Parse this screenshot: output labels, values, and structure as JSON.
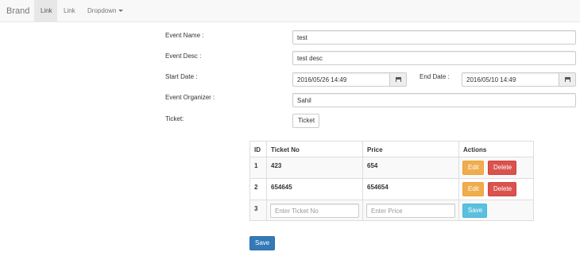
{
  "navbar": {
    "brand": "Brand",
    "items": [
      {
        "label": "Link",
        "active": true
      },
      {
        "label": "Link",
        "active": false
      },
      {
        "label": "Dropdown",
        "active": false
      }
    ]
  },
  "form": {
    "event_name": {
      "label": "Event Name :",
      "value": "test"
    },
    "event_desc": {
      "label": "Event Desc :",
      "value": "test desc"
    },
    "start_date": {
      "label": "Start Date :",
      "value": "2016/05/26 14:49"
    },
    "end_date": {
      "label": "End Date :",
      "value": "2016/05/10 14:49"
    },
    "event_organizer": {
      "label": "Event Organizer :",
      "value": "Sahil"
    },
    "ticket": {
      "label": "Ticket:",
      "button_label": "Ticket"
    }
  },
  "tickets_table": {
    "headers": [
      "ID",
      "Ticket No",
      "Price",
      "Actions"
    ],
    "rows": [
      {
        "id": "1",
        "ticket_no": "423",
        "price": "654"
      },
      {
        "id": "2",
        "ticket_no": "654645",
        "price": "654654"
      }
    ],
    "new_row": {
      "id": "3",
      "ticket_placeholder": "Enter Ticket No",
      "price_placeholder": "Enter Price",
      "save_label": "Save"
    },
    "edit_label": "Edit",
    "delete_label": "Delete"
  },
  "save_label": "Save",
  "icons": {
    "calendar": "calendar-icon",
    "dropdown": "caret-down-icon"
  },
  "colors": {
    "primary": "#337ab7",
    "warning": "#f0ad4e",
    "danger": "#d9534f",
    "info": "#5bc0de",
    "navbar_bg": "#f8f8f8"
  }
}
